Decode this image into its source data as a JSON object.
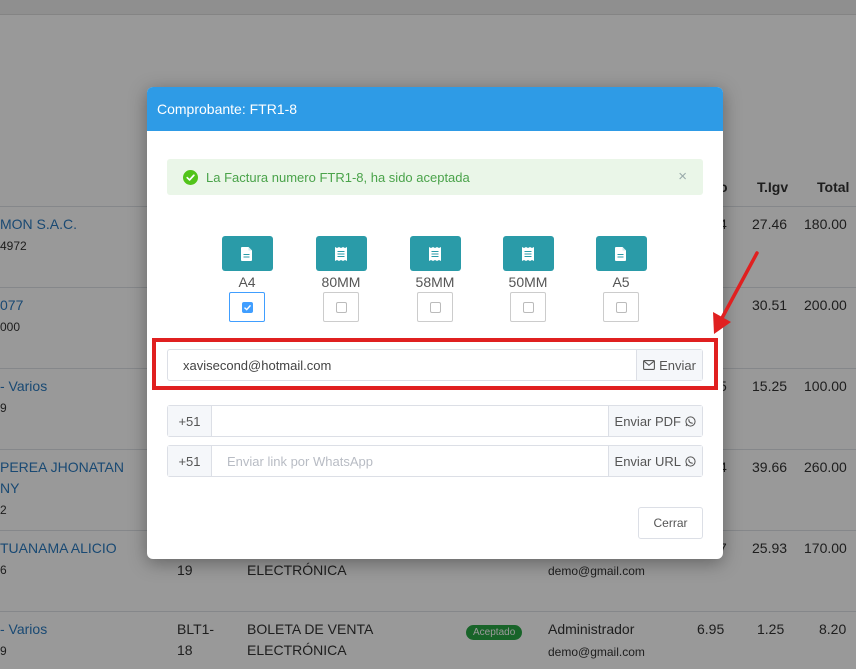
{
  "background": {
    "headers": {
      "total_cut": "o",
      "tigv": "T.Igv",
      "total": "Total"
    },
    "rows": [
      {
        "client": "MON S.A.C.",
        "client2": "",
        "doc": "4972",
        "total_cut": "4",
        "tigv": "27.46",
        "total": "180.00"
      },
      {
        "client": "077",
        "client2": "",
        "doc": "000",
        "total_cut": "",
        "tigv": "30.51",
        "total": "200.00"
      },
      {
        "client": "- Varios",
        "client2": "",
        "doc": "9",
        "total_cut": "5",
        "tigv": "15.25",
        "total": "100.00"
      },
      {
        "client": "PEREA JHONATAN",
        "client2": "NY",
        "doc": "2",
        "total_cut": "4",
        "tigv": "39.66",
        "total": "260.00"
      },
      {
        "client": "TUANAMA ALICIO",
        "client2": "",
        "doc": "6",
        "total_cut": "7",
        "tigv": "25.93",
        "total": "170.00",
        "series_num": "19",
        "doc_type": "ELECTRÓNICA",
        "email": "demo@gmail.com"
      },
      {
        "client": "- Varios",
        "client2": "",
        "doc": "9",
        "series": "BLT1-",
        "series_num": "18",
        "doc_type": "BOLETA DE VENTA",
        "doc_type2": "ELECTRÓNICA",
        "status": "Aceptado",
        "user": "Administrador",
        "email": "demo@gmail.com",
        "total_cut": "6.95",
        "tigv": "1.25",
        "total": "8.20"
      }
    ]
  },
  "modal": {
    "title": "Comprobante: FTR1-8",
    "alert": {
      "message": "La Factura numero FTR1-8, ha sido aceptada",
      "close": "×"
    },
    "formats": [
      {
        "label": "A4",
        "checked": true,
        "icon": "document-icon"
      },
      {
        "label": "80MM",
        "checked": false,
        "icon": "receipt-icon"
      },
      {
        "label": "58MM",
        "checked": false,
        "icon": "receipt-icon"
      },
      {
        "label": "50MM",
        "checked": false,
        "icon": "receipt-icon"
      },
      {
        "label": "A5",
        "checked": false,
        "icon": "document-icon"
      }
    ],
    "email": {
      "value": "xavisecond@hotmail.com",
      "send_label": "Enviar"
    },
    "whatsapp_pdf": {
      "prefix": "+51",
      "value": "",
      "placeholder": "",
      "send_label": "Enviar PDF"
    },
    "whatsapp_url": {
      "prefix": "+51",
      "value": "",
      "placeholder": "Enviar link por WhatsApp",
      "send_label": "Enviar URL"
    },
    "close_label": "Cerrar"
  },
  "colors": {
    "header": "#2e9be6",
    "format_button": "#2a9ba8",
    "success": "#4aa34a",
    "highlight": "#e02020"
  }
}
